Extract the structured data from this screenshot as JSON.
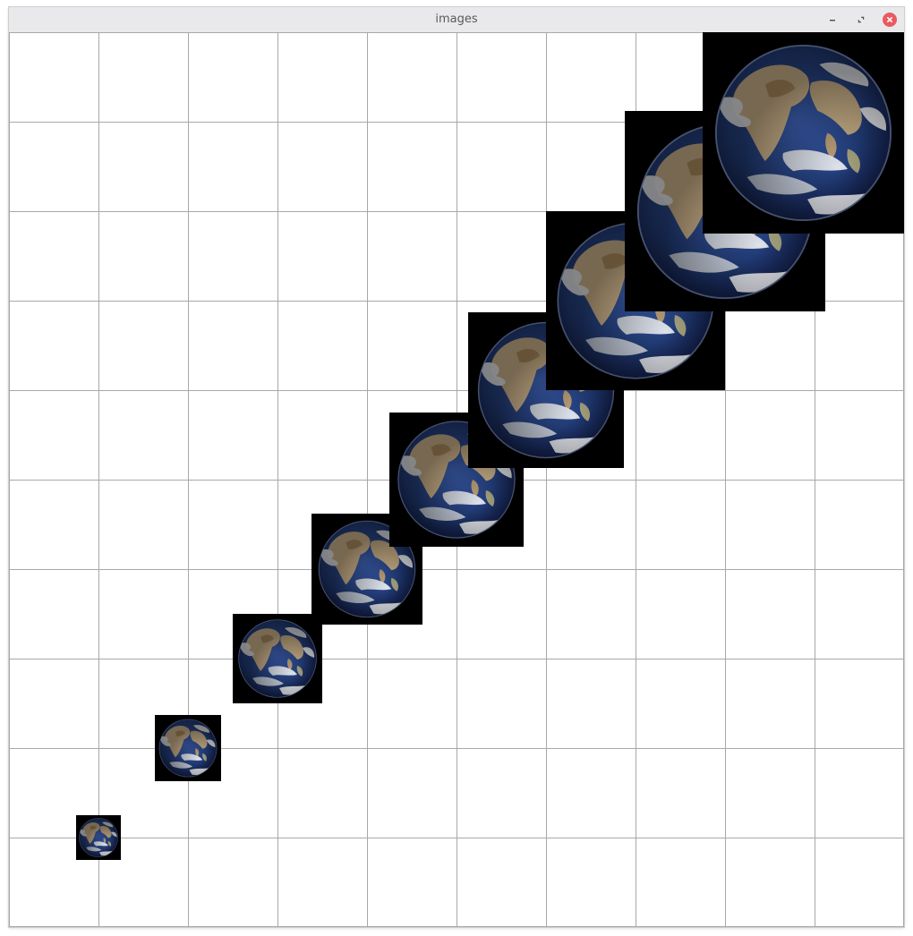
{
  "window": {
    "title": "images",
    "controls": {
      "minimize_icon": "minimize-icon",
      "maximize_icon": "restore-icon",
      "close_icon": "close-icon"
    },
    "colors": {
      "titlebar": "#e9e9ec",
      "close_button": "#e95b5f",
      "grid_line": "#a8a8a8",
      "canvas": "#ffffff"
    }
  },
  "canvas": {
    "grid_rows": 10,
    "grid_columns": 10,
    "image_content": "earth-globe",
    "image_count": 9
  }
}
